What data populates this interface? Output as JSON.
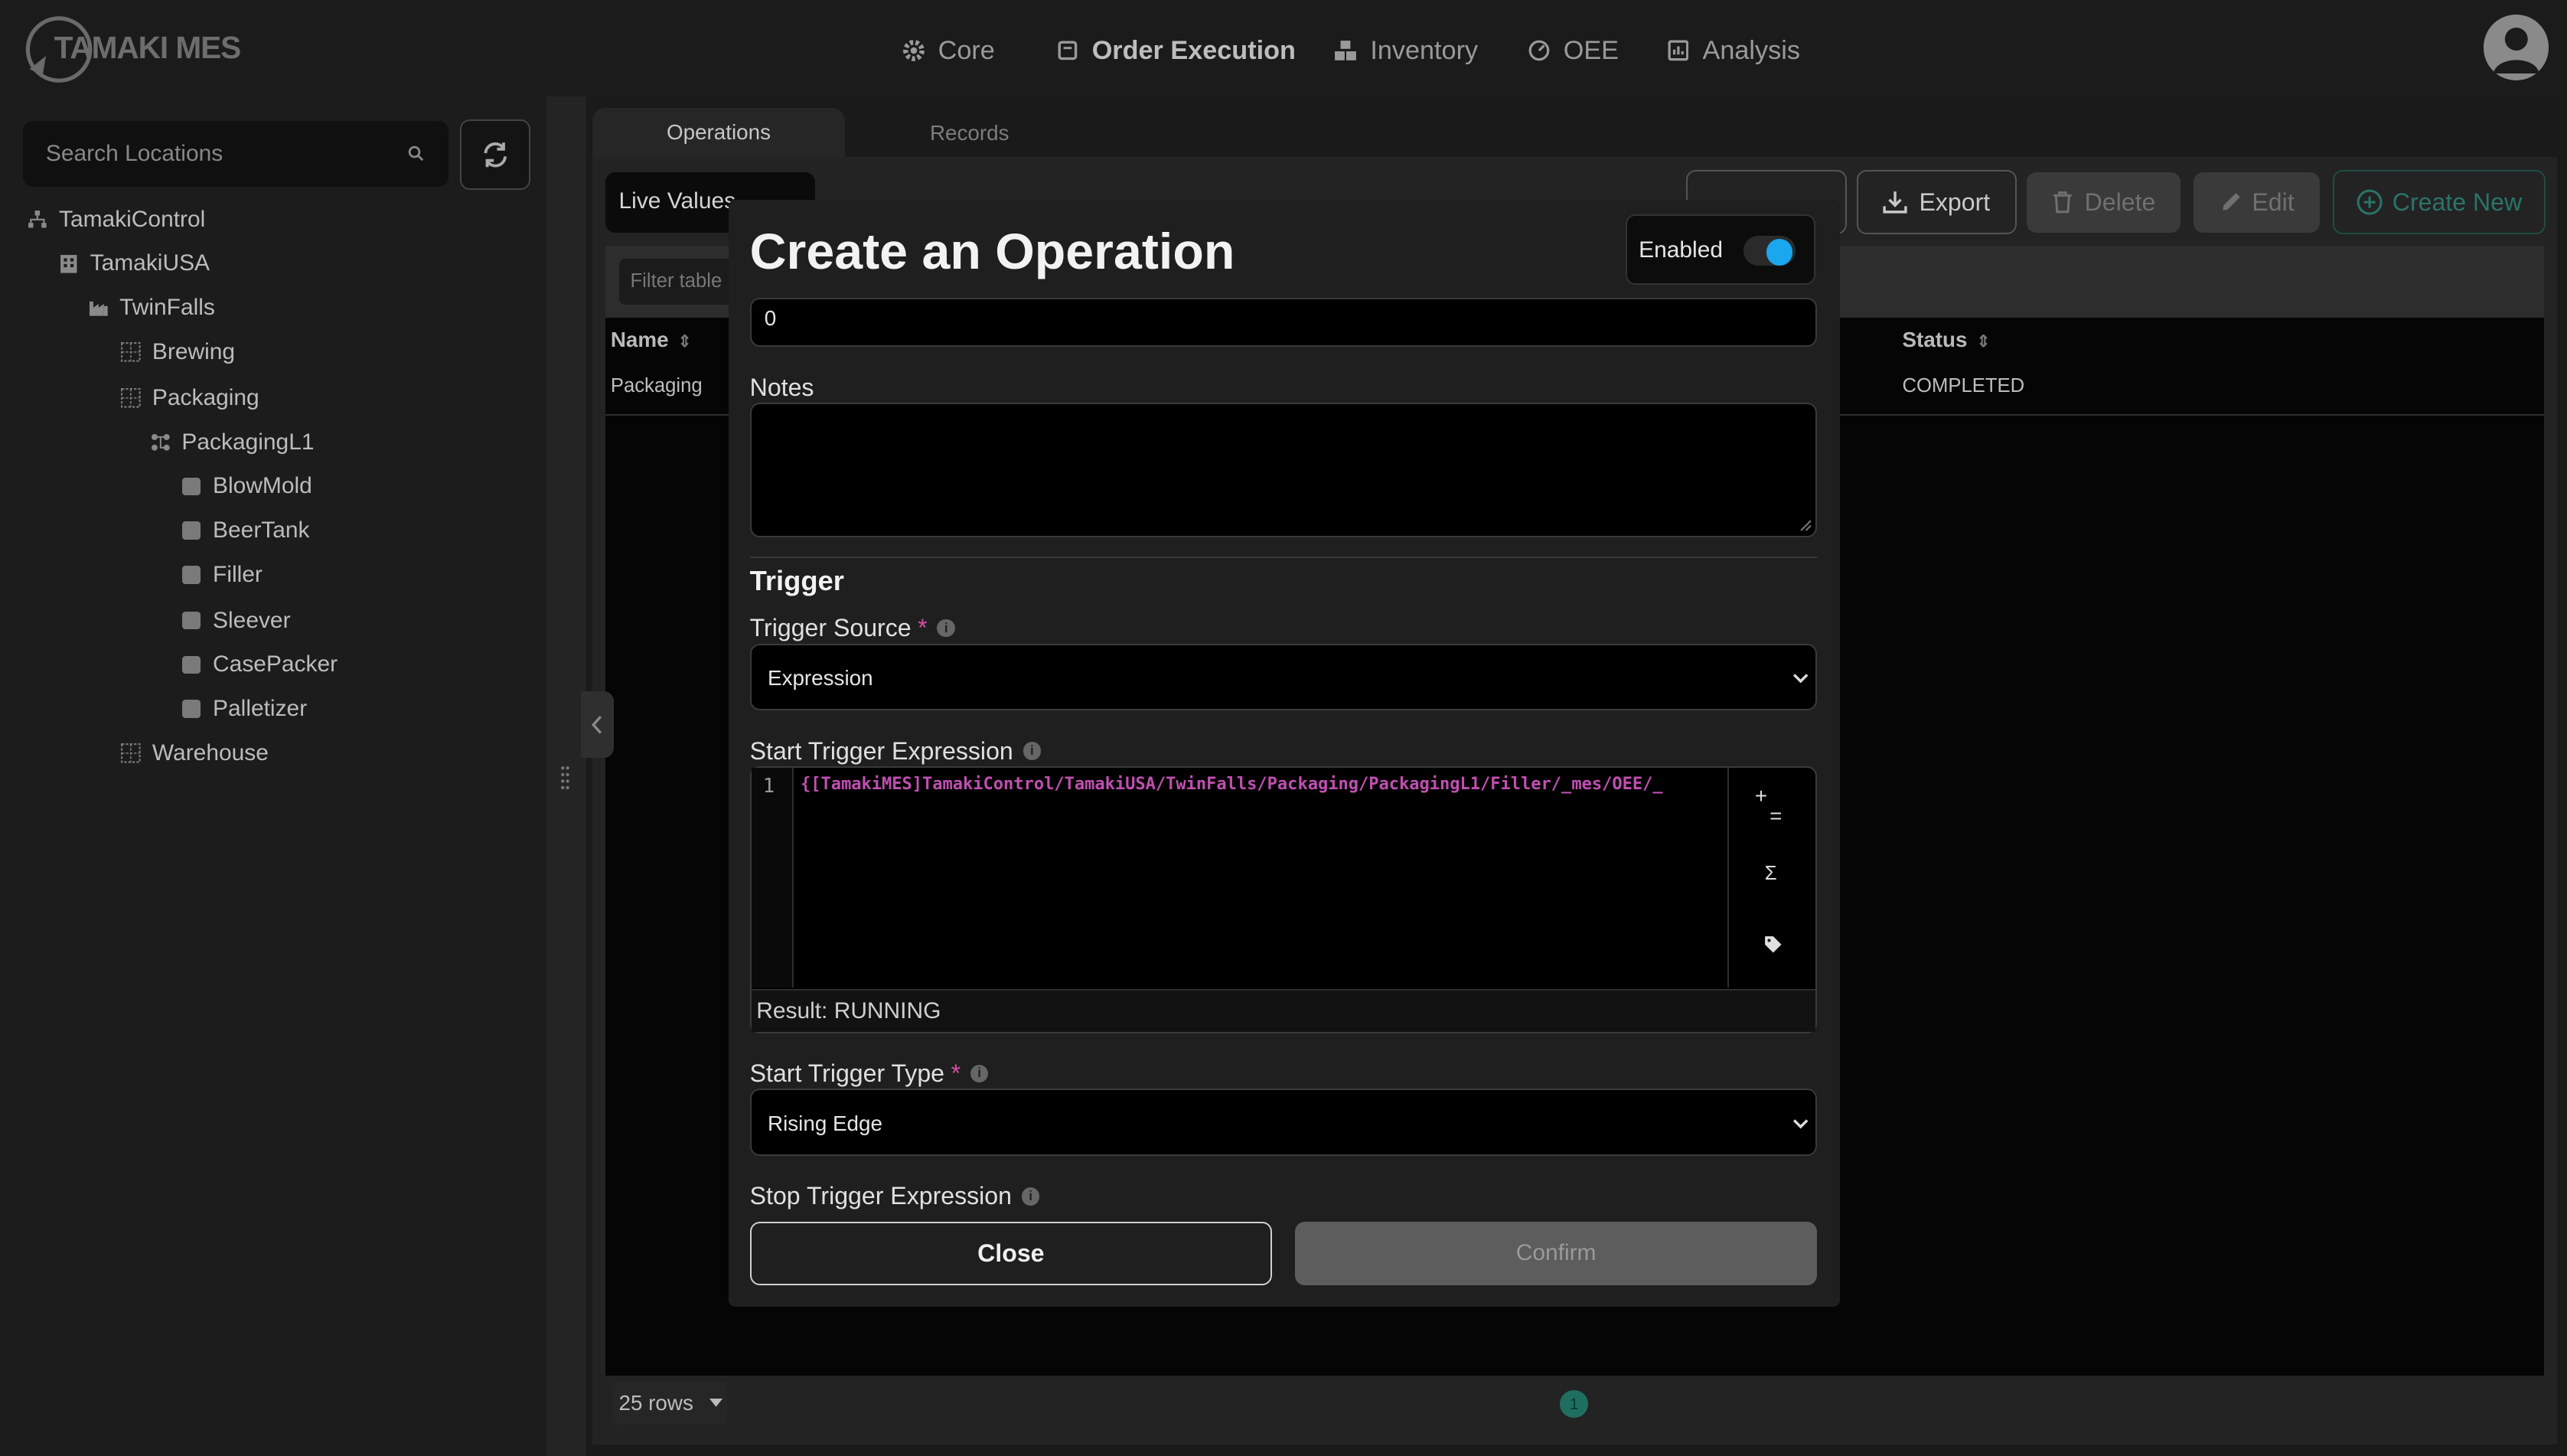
{
  "app": {
    "logo_text": "TAMAKI MES"
  },
  "nav": [
    {
      "label": "Core",
      "icon": "gear-icon"
    },
    {
      "label": "Order Execution",
      "icon": "clipboard-icon"
    },
    {
      "label": "Inventory",
      "icon": "boxes-icon"
    },
    {
      "label": "OEE",
      "icon": "gauge-icon"
    },
    {
      "label": "Analysis",
      "icon": "chart-icon"
    }
  ],
  "sidebar": {
    "search_placeholder": "Search Locations",
    "tree": [
      {
        "label": "TamakiControl",
        "icon": "enterprise-icon"
      },
      {
        "label": "TamakiUSA",
        "icon": "building-icon"
      },
      {
        "label": "TwinFalls",
        "icon": "factory-icon"
      },
      {
        "label": "Brewing",
        "icon": "area-icon"
      },
      {
        "label": "Packaging",
        "icon": "area-icon"
      },
      {
        "label": "PackagingL1",
        "icon": "line-icon"
      },
      {
        "label": "BlowMold",
        "icon": "cell-icon"
      },
      {
        "label": "BeerTank",
        "icon": "cell-icon"
      },
      {
        "label": "Filler",
        "icon": "cell-icon"
      },
      {
        "label": "Sleever",
        "icon": "cell-icon"
      },
      {
        "label": "CasePacker",
        "icon": "cell-icon"
      },
      {
        "label": "Palletizer",
        "icon": "cell-icon"
      },
      {
        "label": "Warehouse",
        "icon": "area-icon"
      }
    ]
  },
  "tabs": {
    "operations": "Operations",
    "records": "Records"
  },
  "toolbar": {
    "live_values": "Live Values",
    "export": "Export",
    "delete": "Delete",
    "edit": "Edit",
    "create_new": "Create New",
    "filter_placeholder": "Filter table"
  },
  "table": {
    "columns": {
      "name": "Name",
      "status": "Status"
    },
    "rows": [
      {
        "name": "Packaging",
        "status": "COMPLETED"
      }
    ],
    "rows_per_page": "25 rows",
    "page": "1"
  },
  "modal": {
    "title": "Create an Operation",
    "enabled_label": "Enabled",
    "enabled": true,
    "top_field_value": "0",
    "notes_label": "Notes",
    "notes_value": "",
    "trigger_heading": "Trigger",
    "trigger_source_label": "Trigger Source",
    "trigger_source_value": "Expression",
    "start_expr_label": "Start Trigger Expression",
    "start_expr_line_no": "1",
    "start_expr_code": "{[TamakiMES]TamakiControl/TamakiUSA/TwinFalls/Packaging/PackagingL1/Filler/_mes/OEE/_",
    "start_expr_result": "Result: RUNNING",
    "start_type_label": "Start Trigger Type",
    "start_type_value": "Rising Edge",
    "stop_expr_label": "Stop Trigger Expression",
    "close": "Close",
    "confirm": "Confirm",
    "required_mark": "*",
    "tools": {
      "operator": "+=",
      "function": "Σ",
      "tag": "tag-icon"
    }
  },
  "colors": {
    "accent_toggle": "#1aa7ee",
    "code_magenta": "#c04fb1",
    "create_green": "#2a7468"
  }
}
